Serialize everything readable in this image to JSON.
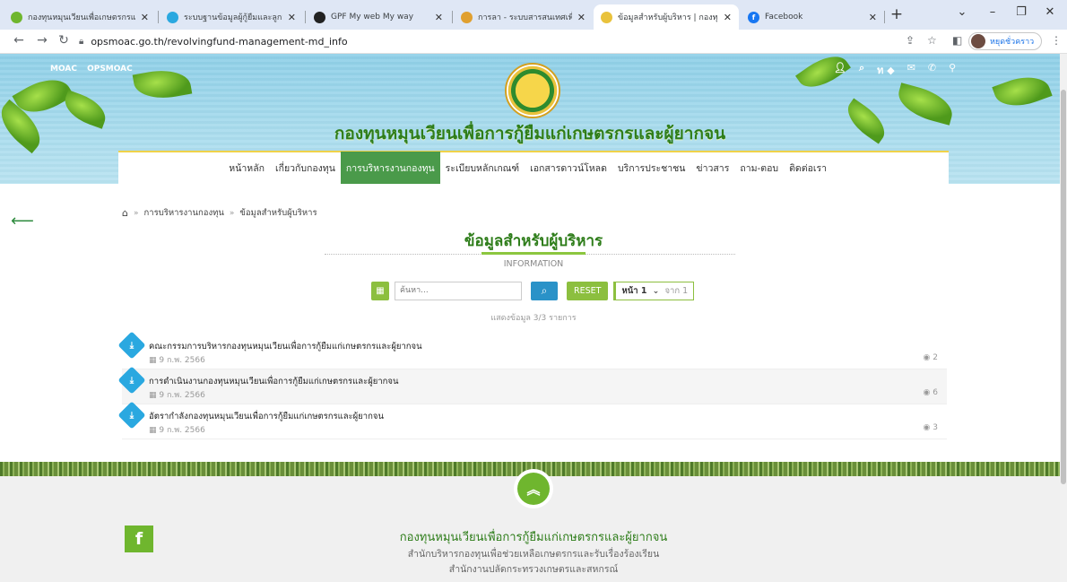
{
  "browser": {
    "tabs": [
      {
        "title": "กองทุนหมุนเวียนเพื่อเกษตรกรแ...",
        "color": "#6fb62e",
        "active": false
      },
      {
        "title": "ระบบฐานข้อมูลผู้กู้ยืมและลูกหนี้...",
        "color": "#2aa8e0",
        "active": false
      },
      {
        "title": "GPF My web My way",
        "color": "#222222",
        "active": false
      },
      {
        "title": "การลา - ระบบสารสนเทศเพื่อการ...",
        "color": "#e0a030",
        "active": false
      },
      {
        "title": "ข้อมูลสำหรับผู้บริหาร | กองทุนห...",
        "color": "#e9c23c",
        "active": true
      },
      {
        "title": "Facebook",
        "color": "#1877f2",
        "active": false
      }
    ],
    "url": "opsmoac.go.th/revolvingfund-management-md_info",
    "profile_name": "หยุดชั่วคราว"
  },
  "site": {
    "top_links": [
      "MOAC",
      "OPSMOAC"
    ],
    "lang_label": "ท",
    "title": "กองทุนหมุนเวียนเพื่อการกู้ยืมแก่เกษตรกรและผู้ยากจน",
    "nav": [
      {
        "label": "หน้าหลัก",
        "active": false
      },
      {
        "label": "เกี่ยวกับกองทุน",
        "active": false
      },
      {
        "label": "การบริหารงานกองทุน",
        "active": true
      },
      {
        "label": "ระเบียบหลักเกณฑ์",
        "active": false
      },
      {
        "label": "เอกสารดาวน์โหลด",
        "active": false
      },
      {
        "label": "บริการประชาชน",
        "active": false
      },
      {
        "label": "ข่าวสาร",
        "active": false
      },
      {
        "label": "ถาม-ตอบ",
        "active": false
      },
      {
        "label": "ติดต่อเรา",
        "active": false
      }
    ]
  },
  "breadcrumb": {
    "items": [
      "การบริหารงานกองทุน",
      "ข้อมูลสำหรับผู้บริหาร"
    ]
  },
  "main": {
    "heading": "ข้อมูลสำหรับผู้บริหาร",
    "subheading": "INFORMATION",
    "search_placeholder": "ค้นหา...",
    "reset_label": "RESET",
    "page_label": "หน้า 1",
    "page_of": "จาก 1",
    "count_text": "แสดงข้อมูล 3/3 รายการ",
    "items": [
      {
        "title": "คณะกรรมการบริหารกองทุนหมุนเวียนเพื่อการกู้ยืมแก่เกษตรกรและผู้ยากจน",
        "date": "9 ก.พ. 2566",
        "views": "2"
      },
      {
        "title": "การดำเนินงานกองทุนหมุนเวียนเพื่อการกู้ยืมแก่เกษตรกรและผู้ยากจน",
        "date": "9 ก.พ. 2566",
        "views": "6"
      },
      {
        "title": "อัตรากำลังกองทุนหมุนเวียนเพื่อการกู้ยืมแก่เกษตรกรและผู้ยากจน",
        "date": "9 ก.พ. 2566",
        "views": "3"
      }
    ]
  },
  "footer": {
    "title": "กองทุนหมุนเวียนเพื่อการกู้ยืมแก่เกษตรกรและผู้ยากจน",
    "line1": "สำนักบริหารกองทุนเพื่อช่วยเหลือเกษตรกรและรับเรื่องร้องเรียน",
    "line2": "สำนักงานปลัดกระทรวงเกษตรและสหกรณ์"
  },
  "icons": {
    "back": "arrow-left-icon",
    "home": "home-icon",
    "calendar": "calendar-icon",
    "search": "search-icon",
    "download": "download-icon",
    "views": "eye-icon",
    "scroll_top": "chevron-double-up-icon",
    "facebook": "facebook-icon"
  },
  "colors": {
    "brand_green": "#2e7d1a",
    "accent_green": "#8cbf3f",
    "nav_active": "#4a9a4a",
    "search_blue": "#2a92c8",
    "download_blue": "#2aa8e0"
  }
}
